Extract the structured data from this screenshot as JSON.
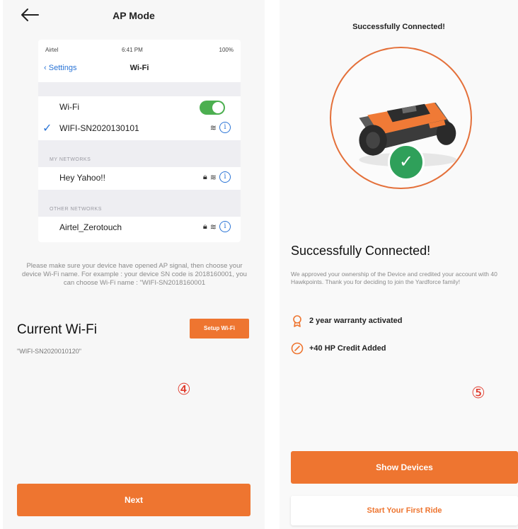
{
  "ap_mode_screen": {
    "title": "AP Mode",
    "back_icon": "back-arrow-icon",
    "ios_screenshot": {
      "status_bar": {
        "carrier": "Airtel",
        "time": "6:41 PM",
        "battery": "100%"
      },
      "nav_back_label": "Settings",
      "nav_title": "Wi-Fi",
      "wifi_label": "Wi-Fi",
      "wifi_enabled": true,
      "connected_network": "WIFI-SN2020130101",
      "my_networks_header": "MY NETWORKS",
      "my_networks": [
        "Hey Yahoo!!"
      ],
      "other_networks_header": "OTHER NETWORKS",
      "other_networks": [
        "Airtel_Zerotouch"
      ]
    },
    "instructions": "Please make sure your device have opened AP signal, then choose your device Wi-Fi name. For example : your device SN code is 2018160001, you can choose Wi-Fi name : \"WIFI-SN2018160001",
    "current_wifi_title": "Current Wi-Fi",
    "setup_wifi_label": "Setup Wi-Fi",
    "current_wifi_value": "\"WIFI-SN2020010120\"",
    "step_marker": "④",
    "next_label": "Next"
  },
  "success_screen": {
    "top_title": "Successfully Connected!",
    "heading": "Successfully Connected!",
    "description": "We approved your ownership of the Device and credited your account with 40 Hawkpoints. Thank you for deciding to join the Yardforce family!",
    "perks": [
      {
        "icon": "award-ribbon-icon",
        "label": "2 year warranty activated"
      },
      {
        "icon": "credit-slash-icon",
        "label": "+40 HP Credit Added"
      }
    ],
    "step_marker": "⑤",
    "show_devices_label": "Show Devices",
    "first_ride_label": "Start Your First Ride"
  },
  "colors": {
    "brand_orange": "#ee7530",
    "success_green": "#2fa05a",
    "ios_blue": "#2a74d6",
    "toggle_green": "#4caf50",
    "step_red": "#e0392b"
  }
}
